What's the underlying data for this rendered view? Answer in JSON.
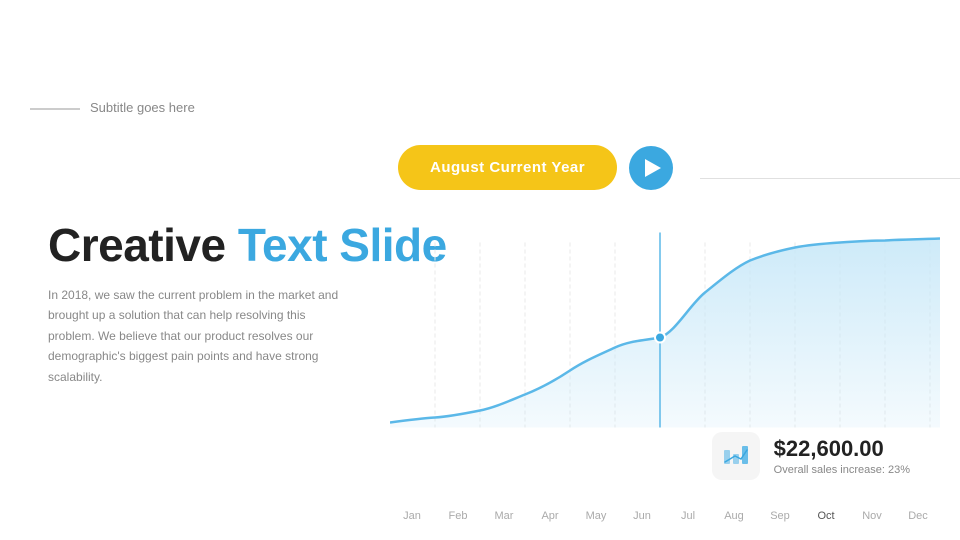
{
  "header": {
    "subtitle": "Subtitle goes here",
    "date_badge": "August Current Year"
  },
  "title": {
    "part1": "Creative ",
    "part2": "Text Slide"
  },
  "description": "In 2018, we saw the current problem in the market and brought up a solution that can help resolving this problem. We believe that our product resolves our demographic's biggest pain points and have strong scalability.",
  "sales": {
    "amount": "$22,600.00",
    "label": "Overall sales increase: 23%"
  },
  "chart": {
    "months": [
      "Jan",
      "Feb",
      "Mar",
      "Apr",
      "May",
      "Jun",
      "Jul",
      "Aug",
      "Sep",
      "Oct",
      "Nov",
      "Dec"
    ],
    "active_month": "Oct",
    "colors": {
      "line": "#5BB8E8",
      "fill": "#C8E8F8",
      "dot": "#3BA8E0",
      "grid": "#e8e8e8"
    }
  },
  "play_button": {
    "aria": "Play"
  }
}
